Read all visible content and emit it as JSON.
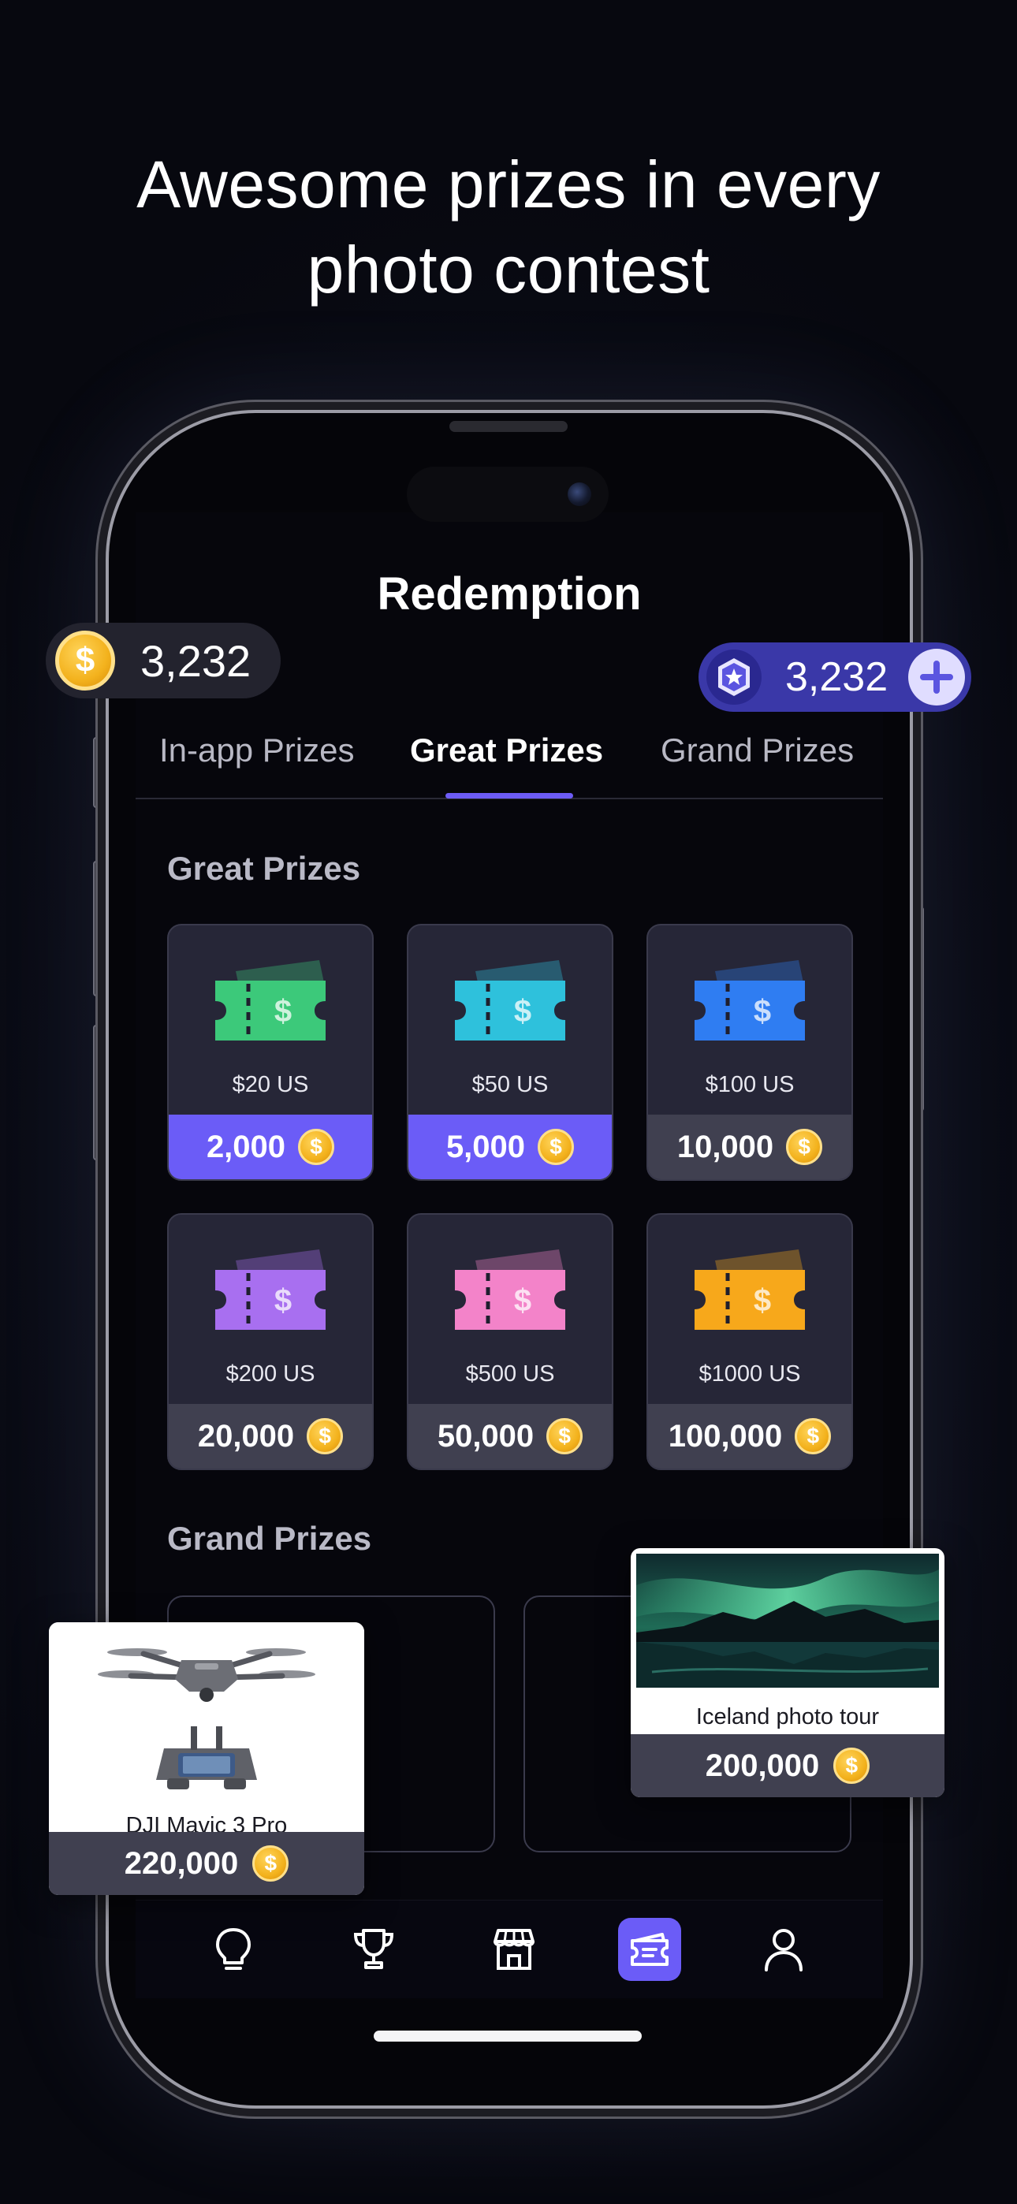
{
  "headline": {
    "line1": "Awesome prizes in every",
    "line2": "photo contest"
  },
  "screen": {
    "title": "Redemption",
    "tabs": [
      {
        "label": "In-app Prizes",
        "active": false
      },
      {
        "label": "Great Prizes",
        "active": true
      },
      {
        "label": "Grand Prizes",
        "active": false
      }
    ],
    "great_section_title": "Great Prizes",
    "great_prizes": [
      {
        "amount": "$20 US",
        "cost": "2,000",
        "color": "#3cc97a",
        "highlight": true
      },
      {
        "amount": "$50 US",
        "cost": "5,000",
        "color": "#2ec1dc",
        "highlight": true
      },
      {
        "amount": "$100 US",
        "cost": "10,000",
        "color": "#2f7df2",
        "highlight": false
      },
      {
        "amount": "$200 US",
        "cost": "20,000",
        "color": "#a86ff0",
        "highlight": false
      },
      {
        "amount": "$500 US",
        "cost": "50,000",
        "color": "#f383c9",
        "highlight": false
      },
      {
        "amount": "$1000 US",
        "cost": "100,000",
        "color": "#f7a81b",
        "highlight": false
      }
    ],
    "grand_section_title": "Grand Prizes",
    "nav": [
      "lightbulb-icon",
      "trophy-icon",
      "store-icon",
      "ticket-icon",
      "profile-icon"
    ]
  },
  "badges": {
    "coins": "3,232",
    "gems": "3,232",
    "coin_symbol": "$"
  },
  "floating_prizes": {
    "drone": {
      "label": "DJI Mavic 3 Pro",
      "cost": "220,000"
    },
    "tour": {
      "label": "Iceland photo tour",
      "cost": "200,000"
    }
  },
  "colors": {
    "accent": "#6b5cf7",
    "coin": "#f3b21d"
  }
}
